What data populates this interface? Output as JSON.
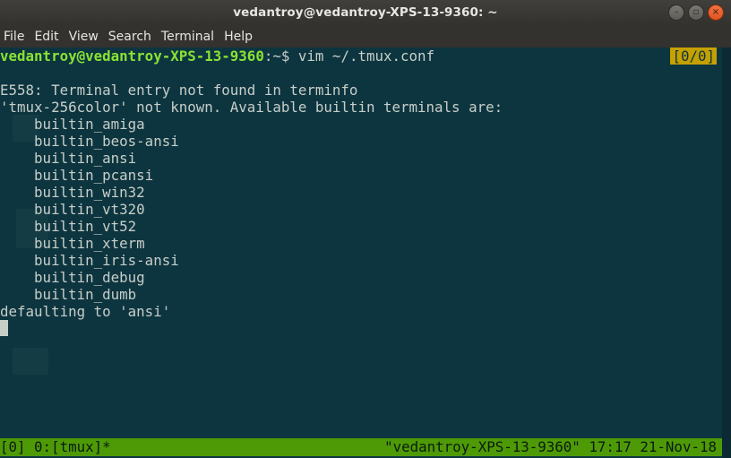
{
  "window": {
    "title": "vedantroy@vedantroy-XPS-13-9360: ~",
    "controls": {
      "minimize": "–",
      "maximize": "▫",
      "close": "×"
    }
  },
  "menu": [
    "File",
    "Edit",
    "View",
    "Search",
    "Terminal",
    "Help"
  ],
  "terminal": {
    "prompt_user": "vedantroy@vedantroy-XPS-13-9360",
    "prompt_path": ":~$",
    "command": " vim ~/.tmux.conf",
    "pane_counter": "[0/0]",
    "output": [
      "E558: Terminal entry not found in terminfo",
      "'tmux-256color' not known. Available builtin terminals are:",
      "    builtin_amiga",
      "    builtin_beos-ansi",
      "    builtin_ansi",
      "    builtin_pcansi",
      "    builtin_win32",
      "    builtin_vt320",
      "    builtin_vt52",
      "    builtin_xterm",
      "    builtin_iris-ansi",
      "    builtin_debug",
      "    builtin_dumb",
      "defaulting to 'ansi'"
    ]
  },
  "tmux_status": {
    "left": "[0] 0:[tmux]*",
    "right": "\"vedantroy-XPS-13-9360\" 17:17 21-Nov-18"
  },
  "colors": {
    "terminal_bg": "#0d3540",
    "prompt_user": "#8ae234",
    "status_bg": "#4e9a06",
    "pane_counter_bg": "#c4a000"
  }
}
